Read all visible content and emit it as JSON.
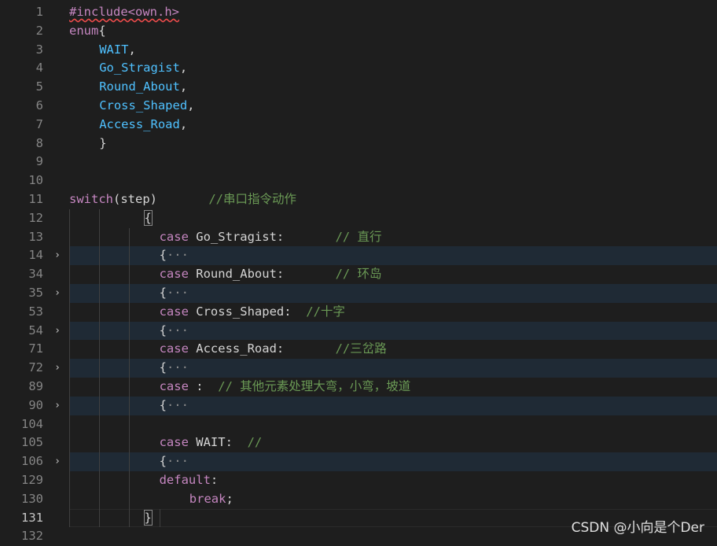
{
  "lines": [
    {
      "n": "1",
      "fold": "",
      "segs": [
        {
          "t": "#include<own.h>",
          "c": "k squiggle"
        }
      ]
    },
    {
      "n": "2",
      "fold": "",
      "segs": [
        {
          "t": "enum",
          "c": "k"
        },
        {
          "t": "{",
          "c": "p"
        }
      ]
    },
    {
      "n": "3",
      "fold": "",
      "indent": 1,
      "segs": [
        {
          "t": "WAIT",
          "c": "v"
        },
        {
          "t": ",",
          "c": "p"
        }
      ]
    },
    {
      "n": "4",
      "fold": "",
      "indent": 1,
      "segs": [
        {
          "t": "Go_Stragist",
          "c": "v"
        },
        {
          "t": ",",
          "c": "p"
        }
      ]
    },
    {
      "n": "5",
      "fold": "",
      "indent": 1,
      "segs": [
        {
          "t": "Round_About",
          "c": "v"
        },
        {
          "t": ",",
          "c": "p"
        }
      ]
    },
    {
      "n": "6",
      "fold": "",
      "indent": 1,
      "segs": [
        {
          "t": "Cross_Shaped",
          "c": "v"
        },
        {
          "t": ",",
          "c": "p"
        }
      ]
    },
    {
      "n": "7",
      "fold": "",
      "indent": 1,
      "segs": [
        {
          "t": "Access_Road",
          "c": "v"
        },
        {
          "t": ",",
          "c": "p"
        }
      ]
    },
    {
      "n": "8",
      "fold": "",
      "indent": 1,
      "segs": [
        {
          "t": "}",
          "c": "p"
        }
      ]
    },
    {
      "n": "9",
      "fold": "",
      "segs": []
    },
    {
      "n": "10",
      "fold": "",
      "segs": []
    },
    {
      "n": "11",
      "fold": "",
      "segs": [
        {
          "t": "switch",
          "c": "k"
        },
        {
          "t": "(step)       ",
          "c": "p"
        },
        {
          "t": "//串口指令动作",
          "c": "c"
        }
      ]
    },
    {
      "n": "12",
      "fold": "",
      "indent": 2,
      "segs": [
        {
          "t": "{",
          "c": "p bracket-box"
        }
      ]
    },
    {
      "n": "13",
      "fold": "",
      "indent": 3,
      "segs": [
        {
          "t": "case",
          "c": "k"
        },
        {
          "t": " Go_Stragist:       ",
          "c": "p"
        },
        {
          "t": "// 直行",
          "c": "c"
        }
      ]
    },
    {
      "n": "14",
      "fold": "›",
      "folded": true,
      "indent": 3,
      "segs": [
        {
          "t": "{",
          "c": "p"
        },
        {
          "t": "···",
          "c": "fold-ellipsis"
        }
      ]
    },
    {
      "n": "34",
      "fold": "",
      "indent": 3,
      "segs": [
        {
          "t": "case",
          "c": "k"
        },
        {
          "t": " Round_About:       ",
          "c": "p"
        },
        {
          "t": "// 环岛",
          "c": "c"
        }
      ]
    },
    {
      "n": "35",
      "fold": "›",
      "folded": true,
      "indent": 3,
      "segs": [
        {
          "t": "{",
          "c": "p"
        },
        {
          "t": "···",
          "c": "fold-ellipsis"
        }
      ]
    },
    {
      "n": "53",
      "fold": "",
      "indent": 3,
      "segs": [
        {
          "t": "case",
          "c": "k"
        },
        {
          "t": " Cross_Shaped:  ",
          "c": "p"
        },
        {
          "t": "//十字",
          "c": "c"
        }
      ]
    },
    {
      "n": "54",
      "fold": "›",
      "folded": true,
      "indent": 3,
      "segs": [
        {
          "t": "{",
          "c": "p"
        },
        {
          "t": "···",
          "c": "fold-ellipsis"
        }
      ]
    },
    {
      "n": "71",
      "fold": "",
      "indent": 3,
      "segs": [
        {
          "t": "case",
          "c": "k"
        },
        {
          "t": " Access_Road:       ",
          "c": "p"
        },
        {
          "t": "//三岔路",
          "c": "c"
        }
      ]
    },
    {
      "n": "72",
      "fold": "›",
      "folded": true,
      "indent": 3,
      "segs": [
        {
          "t": "{",
          "c": "p"
        },
        {
          "t": "···",
          "c": "fold-ellipsis"
        }
      ]
    },
    {
      "n": "89",
      "fold": "",
      "indent": 3,
      "segs": [
        {
          "t": "case",
          "c": "k"
        },
        {
          "t": " :  ",
          "c": "p"
        },
        {
          "t": "// 其他元素处理大弯，小弯，坡道",
          "c": "c"
        }
      ]
    },
    {
      "n": "90",
      "fold": "›",
      "folded": true,
      "indent": 3,
      "segs": [
        {
          "t": "{",
          "c": "p"
        },
        {
          "t": "···",
          "c": "fold-ellipsis"
        }
      ]
    },
    {
      "n": "104",
      "fold": "",
      "indent": 3,
      "segs": []
    },
    {
      "n": "105",
      "fold": "",
      "indent": 3,
      "segs": [
        {
          "t": "case",
          "c": "k"
        },
        {
          "t": " WAIT:  ",
          "c": "p"
        },
        {
          "t": "//",
          "c": "c"
        }
      ]
    },
    {
      "n": "106",
      "fold": "›",
      "folded": true,
      "indent": 3,
      "segs": [
        {
          "t": "{",
          "c": "p"
        },
        {
          "t": "···",
          "c": "fold-ellipsis"
        }
      ]
    },
    {
      "n": "129",
      "fold": "",
      "indent": 3,
      "segs": [
        {
          "t": "default",
          "c": "k"
        },
        {
          "t": ":",
          "c": "p"
        }
      ]
    },
    {
      "n": "130",
      "fold": "",
      "indent": 4,
      "segs": [
        {
          "t": "break",
          "c": "k"
        },
        {
          "t": ";",
          "c": "p"
        }
      ]
    },
    {
      "n": "131",
      "fold": "",
      "current": true,
      "indent": 2,
      "segs": [
        {
          "t": "}",
          "c": "p bracket-box"
        }
      ]
    },
    {
      "n": "132",
      "fold": "",
      "segs": []
    }
  ],
  "watermark": "CSDN @小向是个Der"
}
